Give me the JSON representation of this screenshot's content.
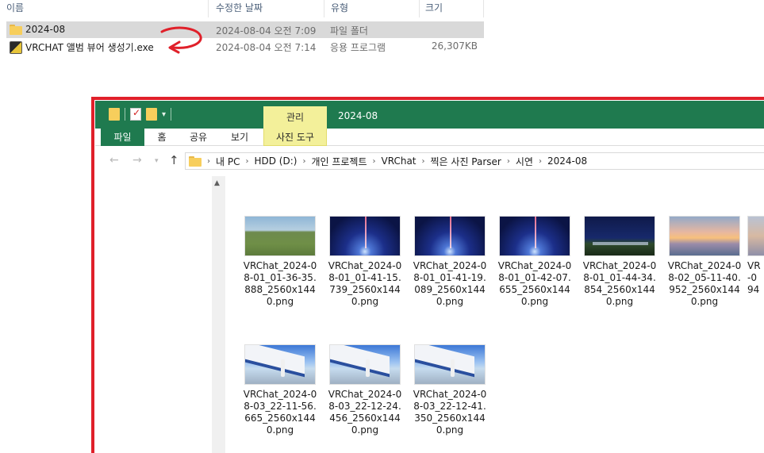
{
  "list": {
    "columns": [
      "이름",
      "수정한 날짜",
      "유형",
      "크기"
    ],
    "rows": [
      {
        "name": "2024-08",
        "date": "2024-08-04 오전 7:09",
        "type": "파일 폴더",
        "size": "",
        "icon": "folder-icon",
        "selected": true
      },
      {
        "name": "VRCHAT 앨범 뷰어 생성기.exe",
        "date": "2024-08-04 오전 7:14",
        "type": "응용 프로그램",
        "size": "26,307KB",
        "icon": "exe-icon",
        "selected": false
      }
    ]
  },
  "annotation": {
    "color": "#e0202a"
  },
  "explorer": {
    "title": "2024-08",
    "context_tab": "관리",
    "ribbon": {
      "file": "파일",
      "home": "홈",
      "share": "공유",
      "view": "보기",
      "photo_tools": "사진 도구"
    },
    "breadcrumb": [
      "내 PC",
      "HDD (D:)",
      "개인 프로젝트",
      "VRChat",
      "찍은 사진 Parser",
      "시연",
      "2024-08"
    ],
    "files": [
      {
        "label": "VRChat_2024-08-01_01-36-35.888_2560x1440.png",
        "thumb": "field"
      },
      {
        "label": "VRChat_2024-08-01_01-41-15.739_2560x1440.png",
        "thumb": "space"
      },
      {
        "label": "VRChat_2024-08-01_01-41-19.089_2560x1440.png",
        "thumb": "space"
      },
      {
        "label": "VRChat_2024-08-01_01-42-07.655_2560x1440.png",
        "thumb": "space"
      },
      {
        "label": "VRChat_2024-08-01_01-44-34.854_2560x1440.png",
        "thumb": "night"
      },
      {
        "label": "VRChat_2024-08-02_05-11-40.952_2560x1440.png",
        "thumb": "sunset"
      },
      {
        "label": "VR\n-0\n94",
        "thumb": "partial"
      },
      {
        "label": "VRChat_2024-08-03_22-11-56.665_2560x1440.png",
        "thumb": "plane"
      },
      {
        "label": "VRChat_2024-08-03_22-12-24.456_2560x1440.png",
        "thumb": "plane"
      },
      {
        "label": "VRChat_2024-08-03_22-12-41.350_2560x1440.png",
        "thumb": "plane"
      }
    ],
    "colors": {
      "titlebar": "#1f7a4f",
      "context_tab": "#f3f09a"
    }
  }
}
